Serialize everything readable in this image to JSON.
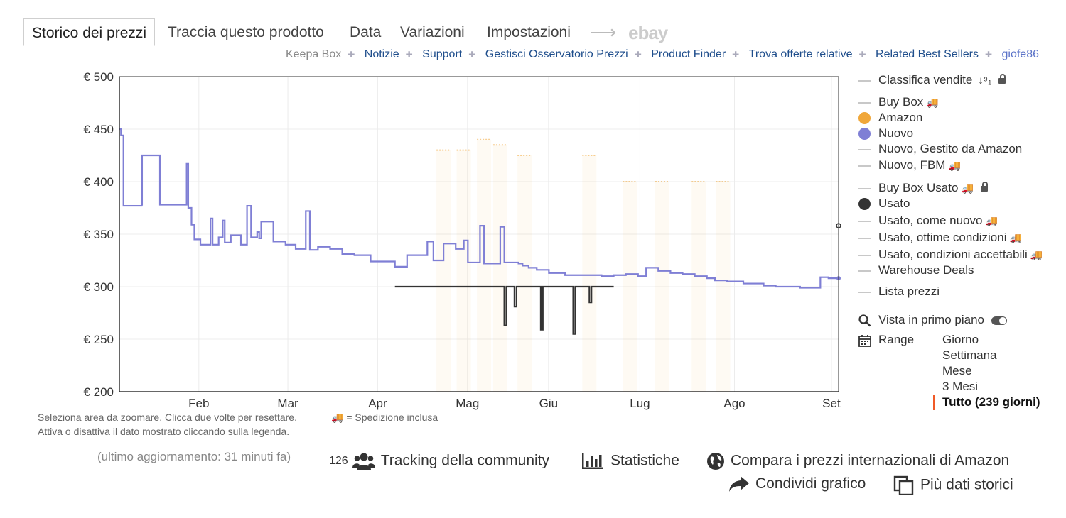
{
  "tabs": {
    "items": [
      "Storico dei prezzi",
      "Traccia questo prodotto",
      "Data",
      "Variazioni",
      "Impostazioni"
    ],
    "ebay_label": "ebay"
  },
  "sublinks": {
    "items": [
      "Keepa Box",
      "Notizie",
      "Support",
      "Gestisci Osservatorio Prezzi",
      "Product Finder",
      "Trova offerte relative",
      "Related Best Sellers",
      "giofe86"
    ]
  },
  "chart_data": {
    "type": "line",
    "x": [
      "Feb",
      "Mar",
      "Apr",
      "Mag",
      "Giu",
      "Lug",
      "Ago",
      "Set"
    ],
    "y_ticks": [
      "€ 500",
      "€ 450",
      "€ 400",
      "€ 350",
      "€ 300",
      "€ 250",
      "€ 200"
    ],
    "ylim": [
      200,
      500
    ],
    "grid": true,
    "series": [
      {
        "name": "Nuovo",
        "color": "#7f7fd5",
        "values": [
          [
            0.0,
            450
          ],
          [
            0.04,
            444
          ],
          [
            0.1,
            377
          ],
          [
            0.55,
            378
          ],
          [
            0.56,
            425
          ],
          [
            1.0,
            378
          ],
          [
            1.65,
            378
          ],
          [
            1.66,
            417
          ],
          [
            1.7,
            375
          ],
          [
            1.78,
            359
          ],
          [
            1.85,
            345
          ],
          [
            2.0,
            340
          ],
          [
            2.2,
            340
          ],
          [
            2.25,
            365
          ],
          [
            2.3,
            340
          ],
          [
            2.45,
            347
          ],
          [
            2.55,
            363
          ],
          [
            2.6,
            342
          ],
          [
            2.75,
            349
          ],
          [
            2.95,
            349
          ],
          [
            3.0,
            340
          ],
          [
            3.15,
            377
          ],
          [
            3.25,
            347
          ],
          [
            3.4,
            352
          ],
          [
            3.45,
            346
          ],
          [
            3.5,
            362
          ],
          [
            3.8,
            343
          ],
          [
            4.1,
            340
          ],
          [
            4.35,
            336
          ],
          [
            4.6,
            372
          ],
          [
            4.7,
            335
          ],
          [
            4.8,
            335
          ],
          [
            4.9,
            338
          ],
          [
            5.2,
            336
          ],
          [
            5.5,
            331
          ],
          [
            5.8,
            330
          ],
          [
            6.2,
            324
          ],
          [
            6.4,
            324
          ],
          [
            6.8,
            319
          ],
          [
            7.1,
            330
          ],
          [
            7.3,
            330
          ],
          [
            7.6,
            343
          ],
          [
            7.75,
            325
          ],
          [
            8.0,
            341
          ],
          [
            8.3,
            336
          ],
          [
            8.5,
            344
          ],
          [
            8.6,
            323
          ],
          [
            8.75,
            323
          ],
          [
            8.9,
            358
          ],
          [
            9.0,
            322
          ],
          [
            9.4,
            357
          ],
          [
            9.5,
            323
          ],
          [
            9.85,
            322
          ],
          [
            9.95,
            320
          ],
          [
            10.1,
            318
          ],
          [
            10.3,
            316
          ],
          [
            10.6,
            313
          ],
          [
            10.8,
            313
          ],
          [
            11.0,
            311
          ],
          [
            11.3,
            311
          ],
          [
            11.6,
            311
          ],
          [
            11.9,
            310
          ],
          [
            12.2,
            311
          ],
          [
            12.5,
            312
          ],
          [
            12.8,
            310
          ],
          [
            13.0,
            318
          ],
          [
            13.3,
            315
          ],
          [
            13.6,
            313
          ],
          [
            13.9,
            312
          ],
          [
            14.2,
            310
          ],
          [
            14.5,
            308
          ],
          [
            14.7,
            306
          ],
          [
            15.0,
            305
          ],
          [
            15.4,
            303
          ],
          [
            15.9,
            301
          ],
          [
            16.2,
            300
          ],
          [
            16.5,
            300
          ],
          [
            16.8,
            299
          ],
          [
            17.05,
            299
          ],
          [
            17.3,
            309
          ],
          [
            17.5,
            308
          ],
          [
            17.75,
            308
          ]
        ]
      },
      {
        "name": "Usato",
        "color": "#333333",
        "values": [
          [
            6.8,
            300
          ],
          [
            9.45,
            300
          ],
          [
            9.5,
            263
          ],
          [
            9.55,
            300
          ],
          [
            9.7,
            300
          ],
          [
            9.75,
            281
          ],
          [
            9.8,
            300
          ],
          [
            10.3,
            300
          ],
          [
            10.4,
            259
          ],
          [
            10.45,
            300
          ],
          [
            11.1,
            300
          ],
          [
            11.2,
            255
          ],
          [
            11.25,
            300
          ],
          [
            11.5,
            300
          ],
          [
            11.6,
            285
          ],
          [
            11.65,
            300
          ],
          [
            12.2,
            300
          ]
        ]
      },
      {
        "name": "Amazon",
        "color": "#f0a73a",
        "values": [
          [
            8.0,
            430
          ],
          [
            8.5,
            430
          ],
          [
            9.0,
            440
          ],
          [
            9.4,
            435
          ],
          [
            10.0,
            425
          ],
          [
            11.6,
            425
          ],
          [
            12.6,
            400
          ],
          [
            13.4,
            400
          ],
          [
            14.3,
            400
          ],
          [
            14.9,
            400
          ]
        ]
      }
    ],
    "footnote_left": "Seleziona area da zoomare. Clicca due volte per resettare.",
    "footnote_left_2": "Attiva o disattiva il dato mostrato cliccando sulla legenda.",
    "footnote_right": "= Spedizione inclusa"
  },
  "legend": {
    "items": [
      {
        "label": "Classifica vendite",
        "marker": "dash",
        "extra": "sort-icon lock-icon"
      },
      {
        "label": "Buy Box",
        "marker": "dash",
        "extra": "truck"
      },
      {
        "label": "Amazon",
        "marker": "dot",
        "color": "#f0a73a"
      },
      {
        "label": "Nuovo",
        "marker": "dot",
        "color": "#7f7fd5"
      },
      {
        "label": "Nuovo, Gestito da Amazon",
        "marker": "dash"
      },
      {
        "label": "Nuovo, FBM",
        "marker": "dash",
        "extra": "truck"
      },
      {
        "label": "Buy Box Usato",
        "marker": "dash",
        "extra": "truck lock-icon"
      },
      {
        "label": "Usato",
        "marker": "dot",
        "color": "#333333"
      },
      {
        "label": "Usato, come nuovo",
        "marker": "dash",
        "extra": "truck"
      },
      {
        "label": "Usato, ottime condizioni",
        "marker": "dash",
        "extra": "truck"
      },
      {
        "label": "Usato, condizioni accettabili",
        "marker": "dash",
        "extra": "truck"
      },
      {
        "label": "Warehouse Deals",
        "marker": "dash"
      },
      {
        "label": "Lista prezzi",
        "marker": "dash"
      }
    ],
    "foreground_label": "Vista in primo piano",
    "range_label": "Range",
    "range_options": [
      "Giorno",
      "Settimana",
      "Mese",
      "3 Mesi",
      "Tutto (239 giorni)"
    ],
    "range_selected": "Tutto (239 giorni)"
  },
  "status": {
    "updated": "(ultimo aggiornamento: 31 minuti fa)"
  },
  "actions": {
    "community_count": "126",
    "community": "Tracking della community",
    "stats": "Statistiche",
    "compare": "Compara i prezzi internazionali di Amazon",
    "share": "Condividi grafico",
    "more": "Più dati storici"
  },
  "colors": {
    "accent": "#f05a28",
    "nuovo": "#7f7fd5",
    "amazon": "#f0a73a",
    "usato": "#333333",
    "link": "#1f4e8c"
  }
}
